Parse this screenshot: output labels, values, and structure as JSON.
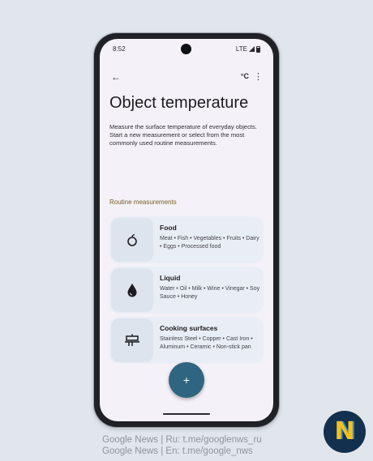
{
  "status_bar": {
    "time": "8:52",
    "network": "LTE"
  },
  "app_bar": {
    "back_icon": "arrow-left-icon",
    "unit_label": "°C",
    "menu_icon": "more-vert-icon"
  },
  "page": {
    "title": "Object temperature",
    "description": "Measure the surface temperature of everyday objects. Start a new measurement or select from the most commonly used routine measurements."
  },
  "routine": {
    "section_label": "Routine measurements",
    "items": [
      {
        "title": "Food",
        "subtitle": "Meat • Fish • Vegetables • Fruits • Dairy • Eggs • Processed food",
        "icon": "apple-icon"
      },
      {
        "title": "Liquid",
        "subtitle": "Water • Oil • Milk • Wine • Vinegar • Soy Sauce • Honey",
        "icon": "water-drop-icon"
      },
      {
        "title": "Cooking surfaces",
        "subtitle": "Stainless Steel • Copper • Cast Iron • Aluminum • Ceramic • Non-stick pan",
        "icon": "cooktop-icon"
      }
    ]
  },
  "fab": {
    "label": "+"
  },
  "watermark": {
    "line1": "Google News | Ru: t.me/googlenws_ru",
    "line2": "Google News | En: t.me/google_nws"
  },
  "logo": {
    "letter": "N"
  }
}
